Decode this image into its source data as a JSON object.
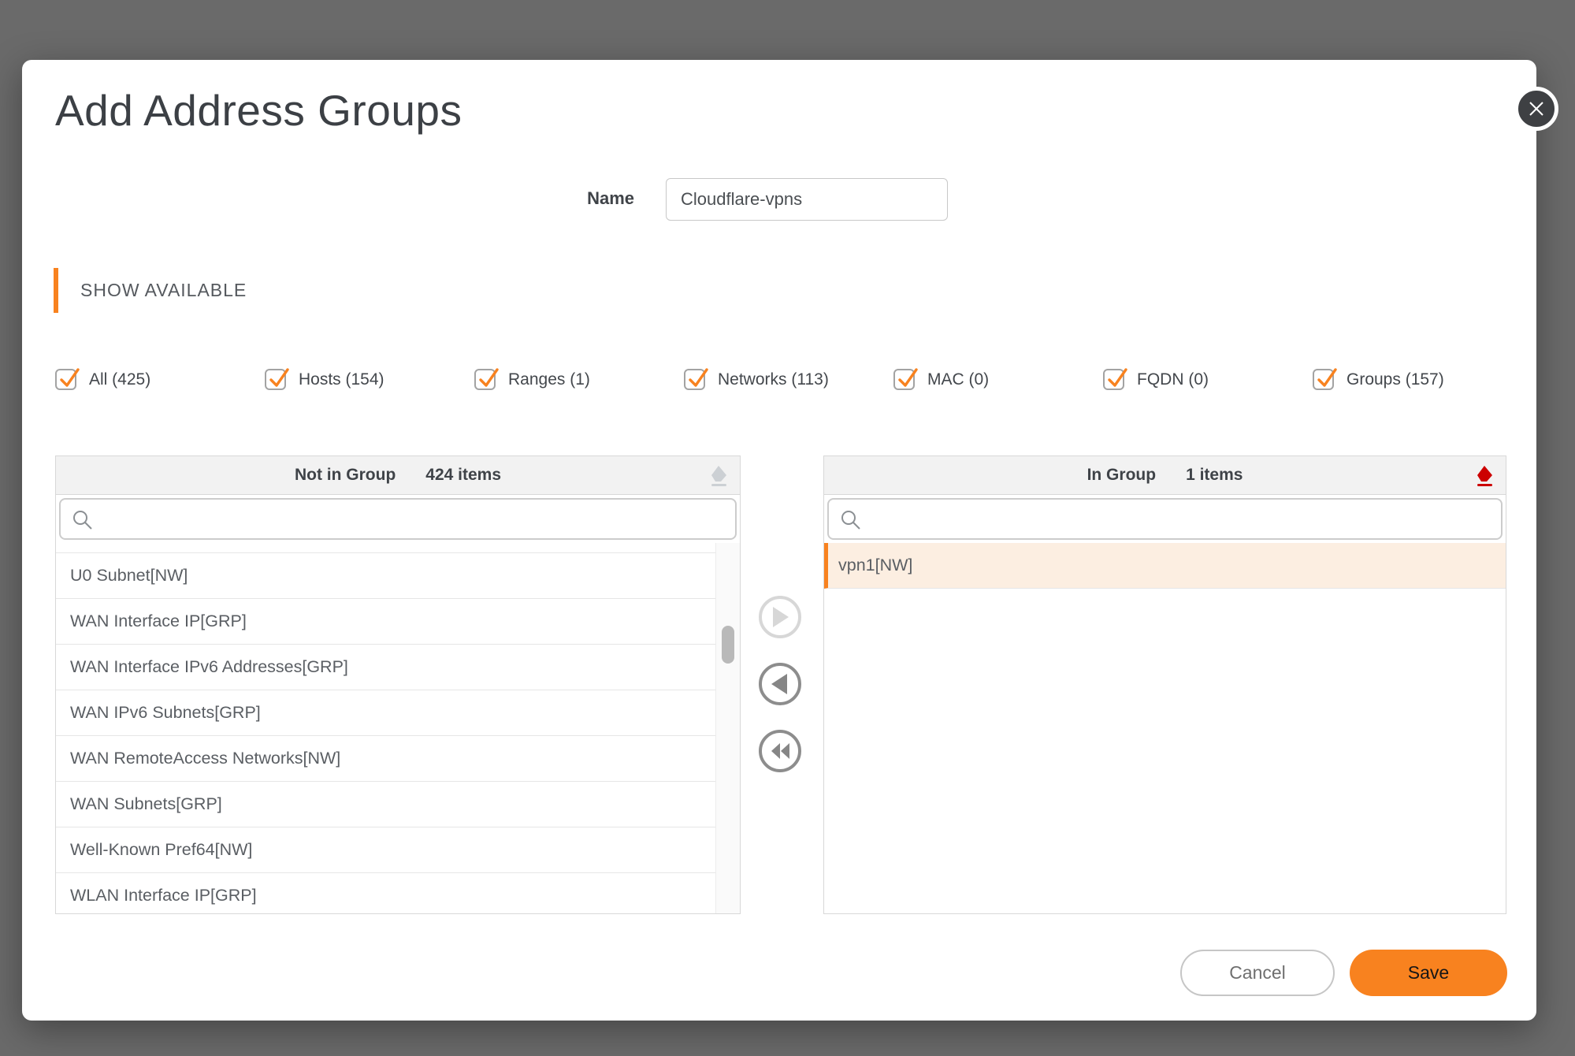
{
  "colors": {
    "accent": "#F8821F",
    "accent_soft": "#FCEEE1",
    "eraser_red": "#CC0000",
    "overlay": "#6A6A6A"
  },
  "modal": {
    "title": "Add Address Groups",
    "name": {
      "label": "Name",
      "value": "Cloudflare-vpns"
    },
    "section_header": "SHOW AVAILABLE",
    "filters": [
      {
        "label": "All (425)",
        "checked": true
      },
      {
        "label": "Hosts (154)",
        "checked": true
      },
      {
        "label": "Ranges (1)",
        "checked": true
      },
      {
        "label": "Networks (113)",
        "checked": true
      },
      {
        "label": "MAC (0)",
        "checked": true
      },
      {
        "label": "FQDN (0)",
        "checked": true
      },
      {
        "label": "Groups (157)",
        "checked": true
      }
    ],
    "left_panel": {
      "title": "Not in Group",
      "count": "424 items",
      "search_placeholder": "",
      "items": [
        "U0 Subnet[NW]",
        "WAN Interface IP[GRP]",
        "WAN Interface IPv6 Addresses[GRP]",
        "WAN IPv6 Subnets[GRP]",
        "WAN RemoteAccess Networks[NW]",
        "WAN Subnets[GRP]",
        "Well-Known Pref64[NW]",
        "WLAN Interface IP[GRP]"
      ]
    },
    "right_panel": {
      "title": "In Group",
      "count": "1 items",
      "search_placeholder": "",
      "items": [
        {
          "label": "vpn1[NW]",
          "selected": true
        }
      ]
    },
    "footer": {
      "cancel": "Cancel",
      "save": "Save"
    }
  }
}
